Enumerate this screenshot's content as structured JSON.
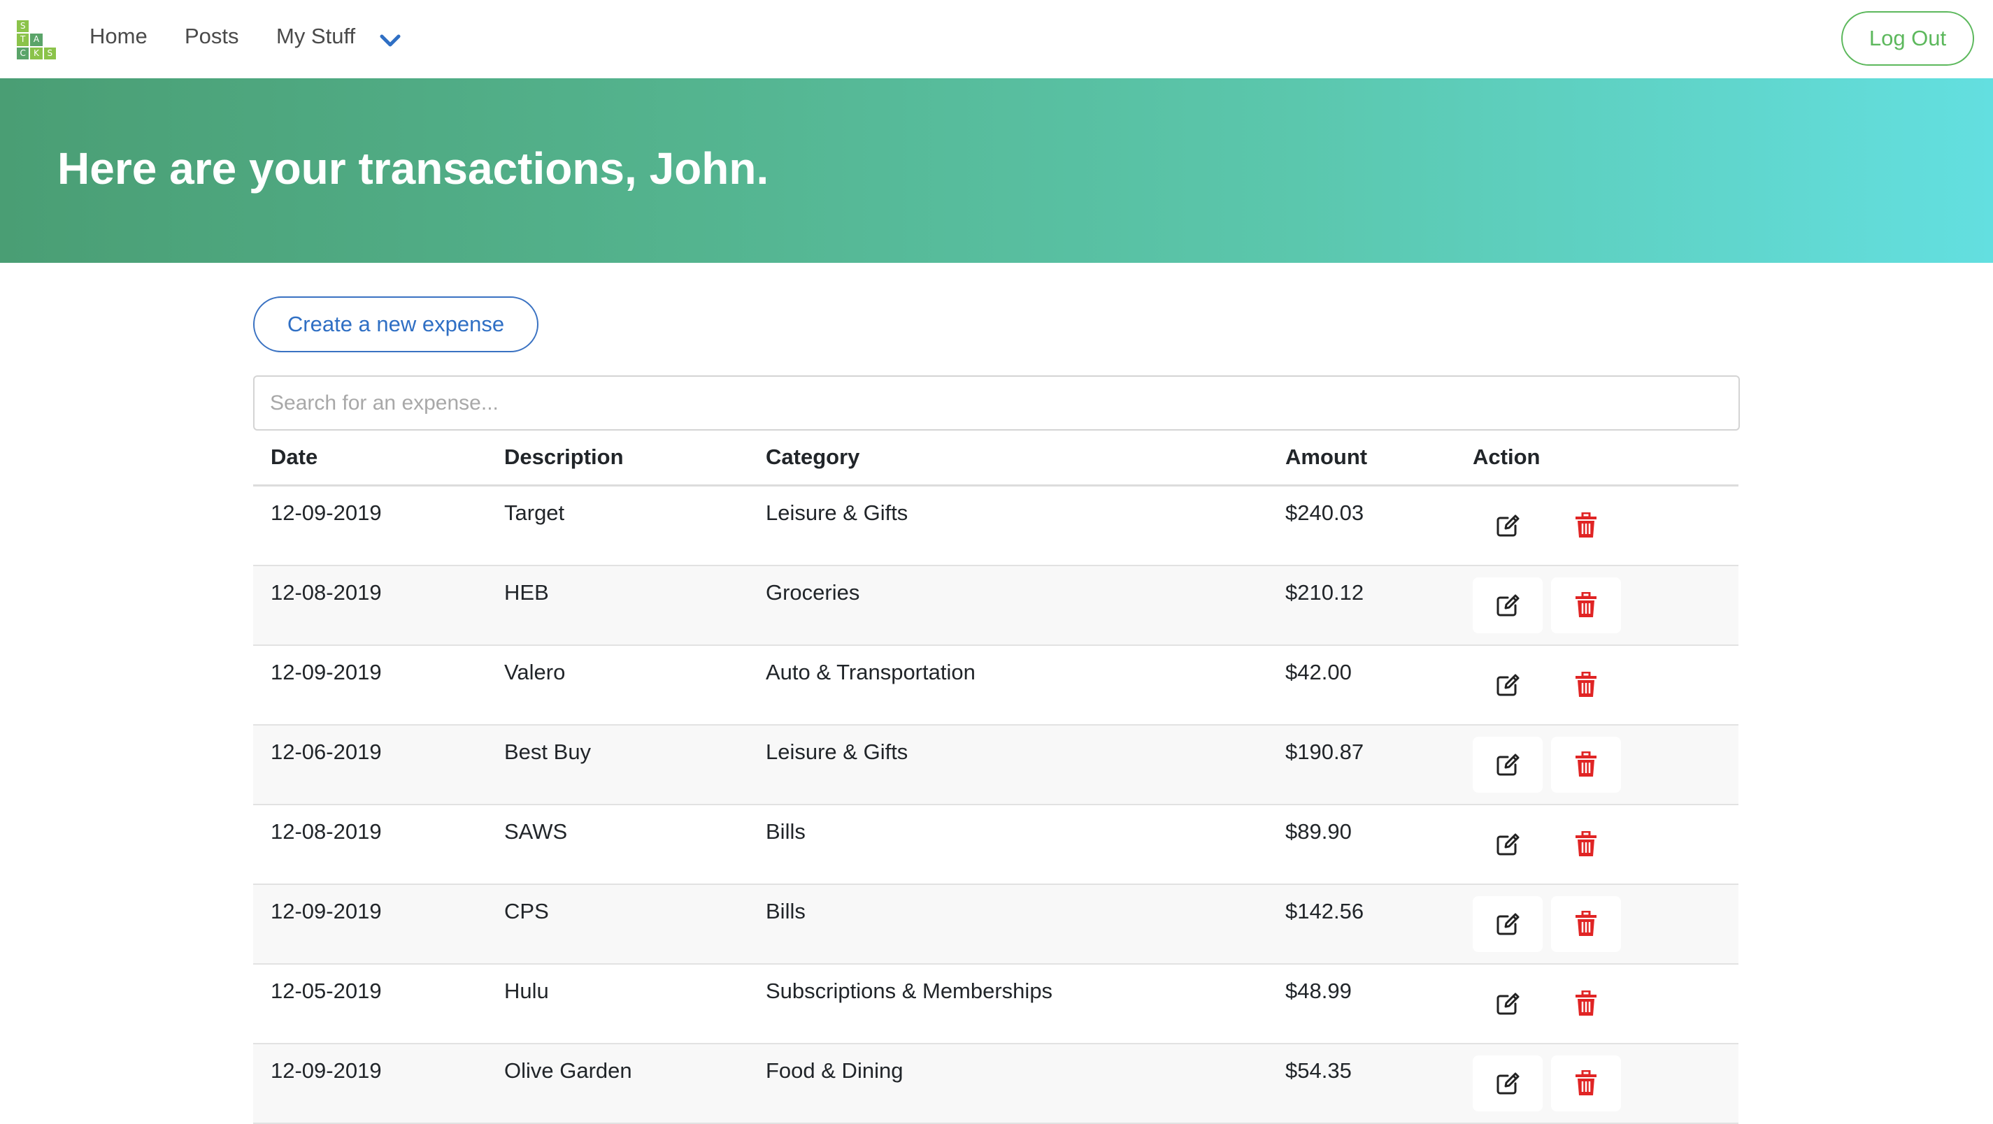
{
  "nav": {
    "logo_letters": [
      "S",
      "",
      "",
      "T",
      "A",
      "",
      "C",
      "K",
      "S"
    ],
    "links": [
      {
        "label": "Home"
      },
      {
        "label": "Posts"
      },
      {
        "label": "My Stuff"
      }
    ],
    "logout_label": "Log Out",
    "brand_color": "#5cb85c"
  },
  "banner": {
    "title": "Here are your transactions, John.",
    "gradient": [
      "#4a9e74",
      "#63dfe0"
    ]
  },
  "create_button": {
    "label": "Create a new expense",
    "color": "#2f6fc4"
  },
  "search": {
    "placeholder": "Search for an expense...",
    "value": ""
  },
  "table": {
    "headers": {
      "date": "Date",
      "description": "Description",
      "category": "Category",
      "amount": "Amount",
      "action": "Action"
    },
    "rows": [
      {
        "date": "12-09-2019",
        "description": "Target",
        "category": "Leisure & Gifts",
        "amount": "$240.03"
      },
      {
        "date": "12-08-2019",
        "description": "HEB",
        "category": "Groceries",
        "amount": "$210.12"
      },
      {
        "date": "12-09-2019",
        "description": "Valero",
        "category": "Auto & Transportation",
        "amount": "$42.00"
      },
      {
        "date": "12-06-2019",
        "description": "Best Buy",
        "category": "Leisure & Gifts",
        "amount": "$190.87"
      },
      {
        "date": "12-08-2019",
        "description": "SAWS",
        "category": "Bills",
        "amount": "$89.90"
      },
      {
        "date": "12-09-2019",
        "description": "CPS",
        "category": "Bills",
        "amount": "$142.56"
      },
      {
        "date": "12-05-2019",
        "description": "Hulu",
        "category": "Subscriptions & Memberships",
        "amount": "$48.99"
      },
      {
        "date": "12-09-2019",
        "description": "Olive Garden",
        "category": "Food & Dining",
        "amount": "$54.35"
      }
    ],
    "action_icons": {
      "edit": "edit-icon",
      "delete": "trash-icon"
    },
    "delete_color": "#e02424"
  }
}
